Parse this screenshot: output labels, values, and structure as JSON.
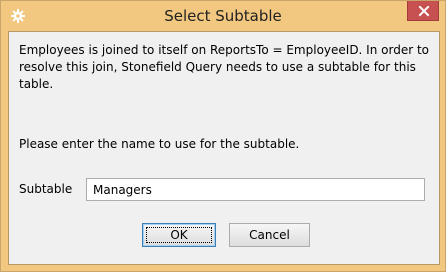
{
  "window": {
    "title": "Select Subtable",
    "app_icon": "gear-icon",
    "close_icon": "close-icon"
  },
  "message": "Employees is joined to itself on ReportsTo = EmployeeID. In order to resolve this join, Stonefield Query needs to use a subtable for this table.",
  "prompt": "Please enter the name to use for the subtable.",
  "subtable": {
    "label": "Subtable",
    "value": "Managers"
  },
  "buttons": {
    "ok": "OK",
    "cancel": "Cancel"
  },
  "colors": {
    "frame": "#f2c77f",
    "close_button": "#c75050",
    "client_background": "#f0f0f0"
  }
}
